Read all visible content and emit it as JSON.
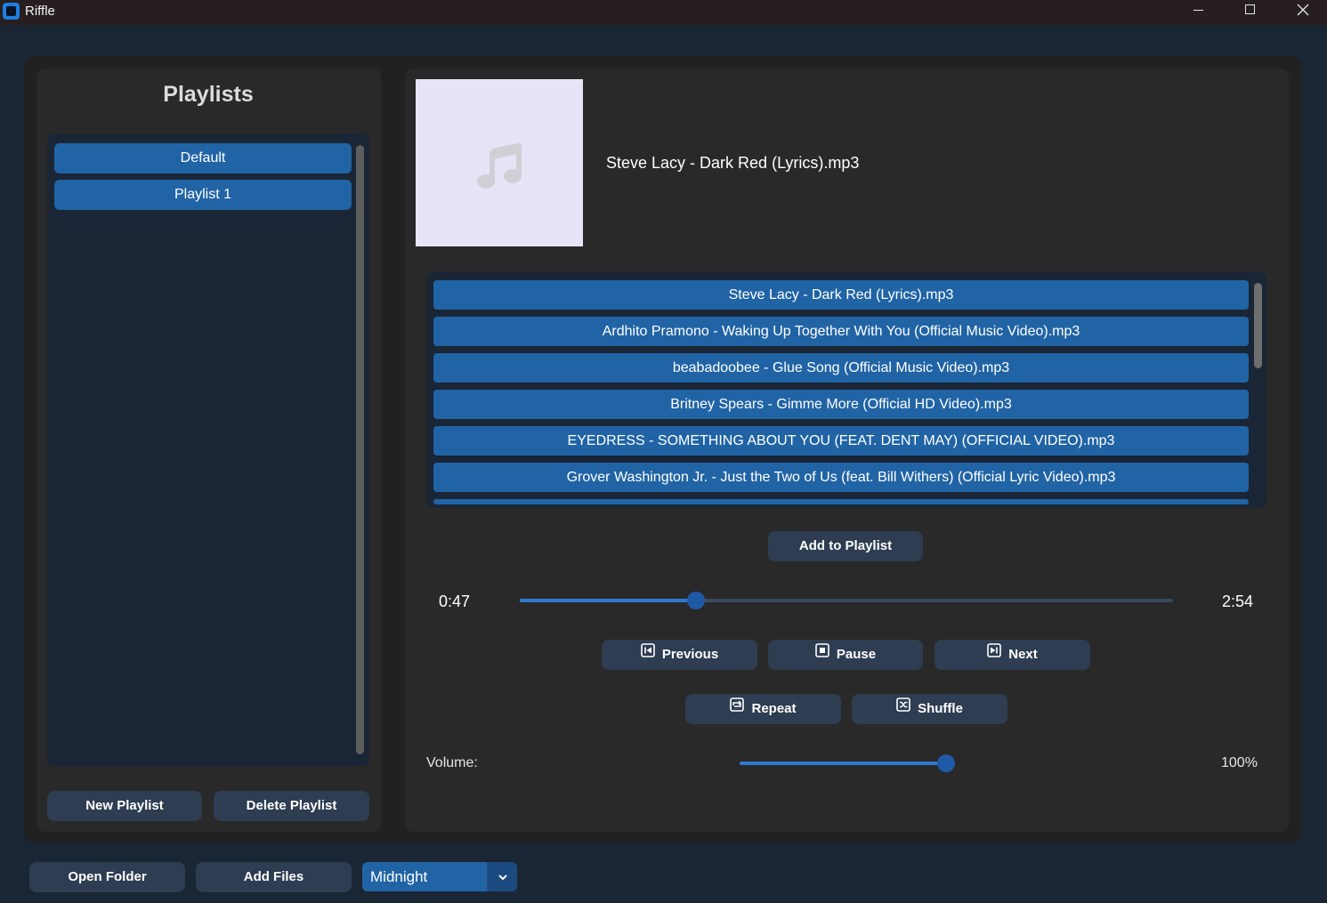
{
  "window": {
    "title": "Riffle"
  },
  "sidebar": {
    "title": "Playlists",
    "playlists": [
      "Default",
      "Playlist 1"
    ],
    "new_playlist_label": "New Playlist",
    "delete_playlist_label": "Delete Playlist"
  },
  "player": {
    "now_playing": "Steve Lacy - Dark Red (Lyrics).mp3",
    "tracks": [
      "Steve Lacy - Dark Red (Lyrics).mp3",
      "Ardhito Pramono - Waking Up Together With You (Official Music Video).mp3",
      "beabadoobee - Glue Song (Official Music Video).mp3",
      "Britney Spears - Gimme More (Official HD Video).mp3",
      "EYEDRESS - SOMETHING ABOUT YOU (FEAT. DENT MAY) (OFFICIAL VIDEO).mp3",
      "Grover Washington Jr. - Just the Two of Us (feat. Bill Withers) (Official Lyric Video).mp3"
    ],
    "add_to_playlist_label": "Add to Playlist",
    "elapsed": "0:47",
    "duration": "2:54",
    "progress_fraction": 0.27,
    "previous_label": "Previous",
    "pause_label": "Pause",
    "next_label": "Next",
    "repeat_label": "Repeat",
    "shuffle_label": "Shuffle",
    "volume_label": "Volume:",
    "volume_value": "100%",
    "volume_fraction": 1.0
  },
  "footer": {
    "open_folder_label": "Open Folder",
    "add_files_label": "Add Files",
    "theme_value": "Midnight"
  },
  "colors": {
    "accent": "#2164a5",
    "knob": "#1f5aa6",
    "button": "#2e3d52",
    "list_background": "#1a2535"
  },
  "icons": {
    "album_art": "music-note-icon",
    "previous": "previous-icon",
    "pause": "pause-icon",
    "next": "next-icon",
    "repeat": "repeat-icon",
    "shuffle": "shuffle-icon"
  }
}
